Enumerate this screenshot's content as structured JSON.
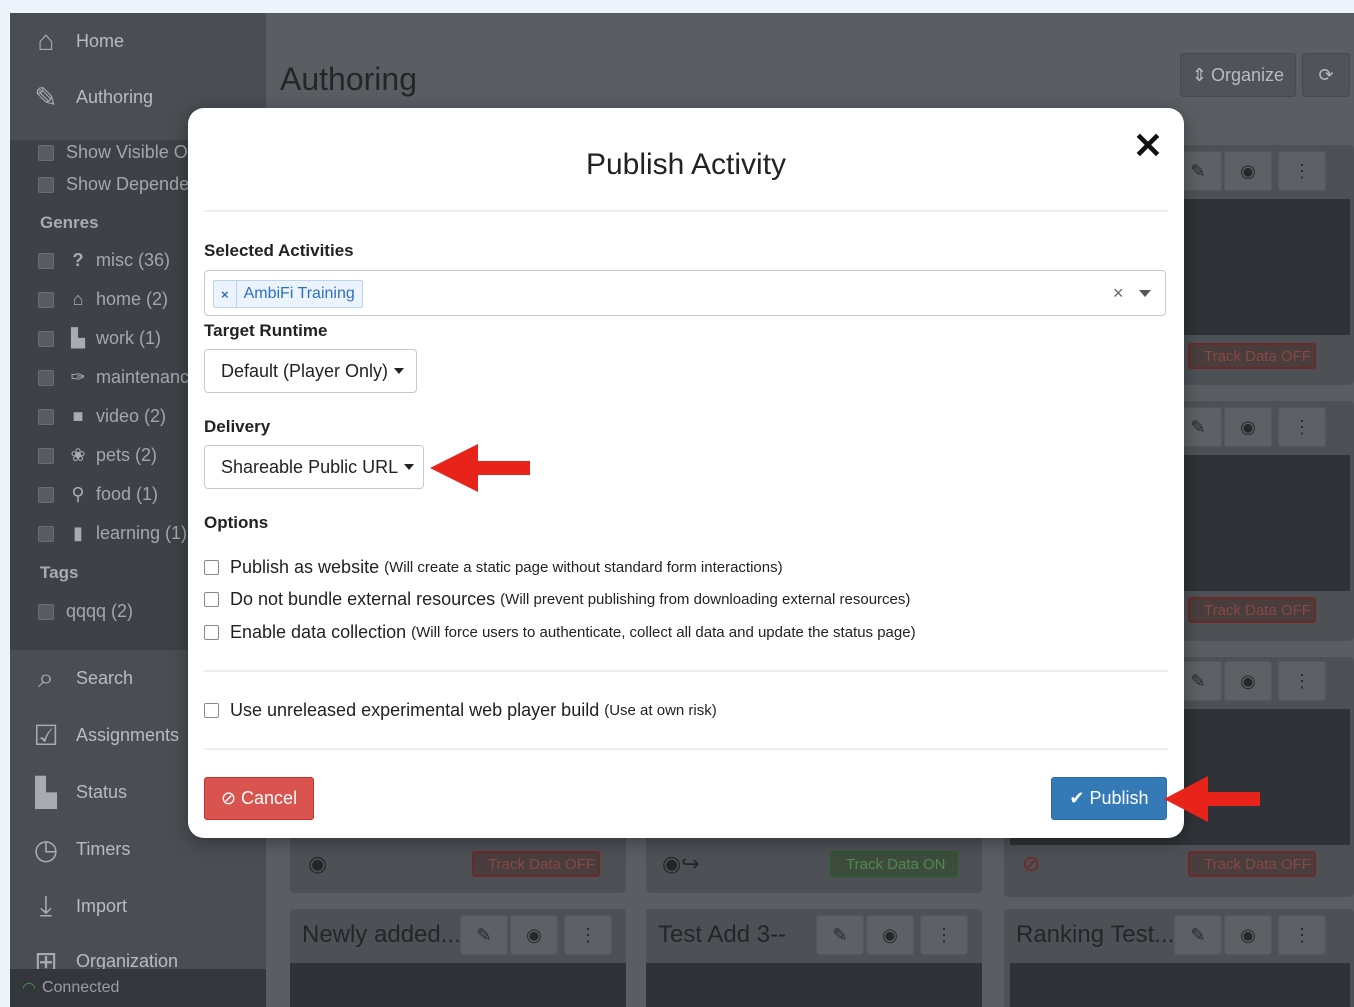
{
  "sidebar": {
    "nav_top": [
      {
        "label": "Home",
        "icon": "home-icon"
      },
      {
        "label": "Authoring",
        "icon": "edit-icon"
      }
    ],
    "filters": [
      "Show Visible O",
      "Show Depende"
    ],
    "genres_heading": "Genres",
    "genres": [
      {
        "label": "misc (36)",
        "icon": "question-icon",
        "glyph": "?"
      },
      {
        "label": "home (2)",
        "icon": "home-icon",
        "glyph": "⌂"
      },
      {
        "label": "work (1)",
        "icon": "chart-icon",
        "glyph": "▙"
      },
      {
        "label": "maintenanc",
        "icon": "wrench-icon",
        "glyph": "🔧"
      },
      {
        "label": "video (2)",
        "icon": "video-camera-icon",
        "glyph": "■"
      },
      {
        "label": "pets (2)",
        "icon": "paw-icon",
        "glyph": "❀"
      },
      {
        "label": "food (1)",
        "icon": "spoon-icon",
        "glyph": "⚲"
      },
      {
        "label": "learning (1)",
        "icon": "book-icon",
        "glyph": "▮"
      }
    ],
    "tags_heading": "Tags",
    "tags": [
      "qqqq (2)"
    ],
    "nav_bottom": [
      {
        "label": "Search",
        "icon": "search-icon"
      },
      {
        "label": "Assignments",
        "icon": "calendar-check-icon"
      },
      {
        "label": "Status",
        "icon": "bar-chart-icon"
      },
      {
        "label": "Timers",
        "icon": "clock-icon"
      },
      {
        "label": "Import",
        "icon": "download-icon"
      },
      {
        "label": "Organization",
        "icon": "grid-icon"
      }
    ],
    "status": "Connected"
  },
  "main": {
    "title": "Authoring",
    "organize_label": "Organize",
    "cards_row4_titles": [
      "Newly added...",
      "Test Add 3--",
      "Ranking Test..."
    ],
    "track_labels": {
      "off": "Track Data OFF",
      "on": "Track Data ON"
    }
  },
  "modal": {
    "title": "Publish Activity",
    "selected_label": "Selected Activities",
    "selected_tag": "AmbiFi Training",
    "runtime_label": "Target Runtime",
    "runtime_value": "Default (Player Only)",
    "delivery_label": "Delivery",
    "delivery_value": "Shareable Public URL",
    "options_label": "Options",
    "options": [
      {
        "label": "Publish as website",
        "note": "(Will create a static page without standard form interactions)"
      },
      {
        "label": "Do not bundle external resources",
        "note": "(Will prevent publishing from downloading external resources)"
      },
      {
        "label": "Enable data collection",
        "note": "(Will force users to authenticate, collect all data and update the status page)"
      }
    ],
    "experimental": {
      "label": "Use unreleased experimental web player build",
      "note": "(Use at own risk)"
    },
    "cancel_label": "Cancel",
    "publish_label": "Publish"
  },
  "colors": {
    "accent_blue": "#337ab7",
    "danger_red": "#d9534f",
    "annotation_arrow": "#e8231a"
  }
}
